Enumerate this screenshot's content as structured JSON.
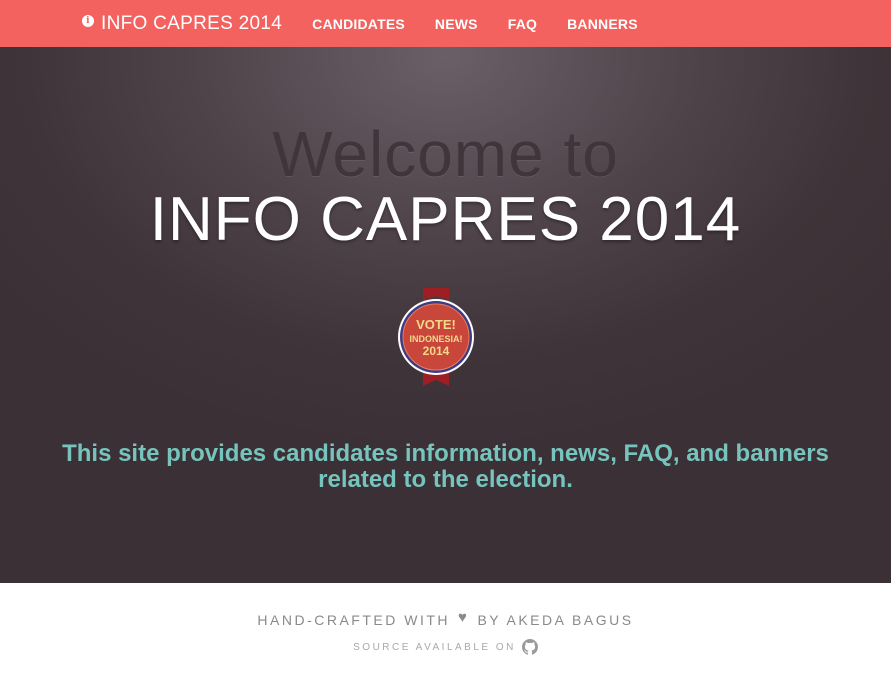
{
  "nav": {
    "brand_text": "INFO CAPRES 2014",
    "brand_icon": "info-icon",
    "links": [
      {
        "label": "CANDIDATES"
      },
      {
        "label": "NEWS"
      },
      {
        "label": "FAQ"
      },
      {
        "label": "BANNERS"
      }
    ],
    "background": "#f3625f"
  },
  "hero": {
    "welcome": "Welcome to",
    "title": "INFO CAPRES 2014",
    "badge": {
      "line1": "VOTE!",
      "line2": "INDONESIA!",
      "line3": "2014"
    },
    "tagline": "This site provides candidates information, news, FAQ, and banners related to the election."
  },
  "footer": {
    "handcrafted_prefix": "HAND-CRAFTED WITH",
    "handcrafted_icon": "heart-icon",
    "handcrafted_suffix": "BY AKEDA BAGUS",
    "source_text": "SOURCE AVAILABLE ON",
    "source_icon": "github-icon"
  },
  "colors": {
    "accent": "#f3625f",
    "tagline": "#76c4bd",
    "hero_dark": "#3a3035"
  }
}
